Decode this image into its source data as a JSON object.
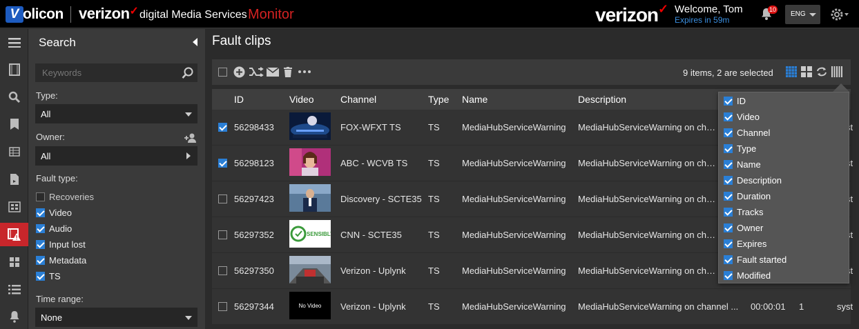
{
  "header": {
    "logo_volicon_v": "V",
    "logo_volicon_rest": "olicon",
    "brand_verizon": "verizon",
    "brand_check": "✓",
    "brand_dms": "digital Media Services",
    "brand_monitor": "Monitor",
    "brand_verizon_right": "verizon",
    "welcome": "Welcome, Tom",
    "expires": "Expires in 59m",
    "notifications_count": "10",
    "language": "ENG"
  },
  "rail": {
    "icons": [
      "menu-icon",
      "film-icon",
      "search-icon",
      "bookmark-icon",
      "table-icon",
      "document-icon",
      "grid-box-icon",
      "fault-clips-icon",
      "dashboard-icon",
      "list-icon",
      "bell-icon"
    ],
    "active": "fault-clips-icon"
  },
  "search": {
    "title": "Search",
    "keywords_placeholder": "Keywords",
    "type_label": "Type:",
    "type_value": "All",
    "owner_label": "Owner:",
    "owner_value": "All",
    "fault_type_label": "Fault type:",
    "fault_types": [
      {
        "label": "Recoveries",
        "checked": false
      },
      {
        "label": "Video",
        "checked": true
      },
      {
        "label": "Audio",
        "checked": true
      },
      {
        "label": "Input lost",
        "checked": true
      },
      {
        "label": "Metadata",
        "checked": true
      },
      {
        "label": "TS",
        "checked": true
      }
    ],
    "time_range_label": "Time range:",
    "time_range_value": "None"
  },
  "main": {
    "title": "Fault clips",
    "status": "9 items, 2 are selected",
    "columns": [
      "ID",
      "Video",
      "Channel",
      "Type",
      "Name",
      "Description"
    ],
    "rows": [
      {
        "checked": true,
        "id": "56298433",
        "channel": "FOX-WFXT TS",
        "type": "TS",
        "name": "MediaHubServiceWarning",
        "description": "MediaHubServiceWarning on channel",
        "duration": "",
        "tracks": "",
        "owner": "syst",
        "thumb": "fox"
      },
      {
        "checked": true,
        "id": "56298123",
        "channel": "ABC - WCVB TS",
        "type": "TS",
        "name": "MediaHubServiceWarning",
        "description": "MediaHubServiceWarning on channel",
        "duration": "",
        "tracks": "",
        "owner": "syst",
        "thumb": "abc"
      },
      {
        "checked": false,
        "id": "56297423",
        "channel": "Discovery - SCTE35",
        "type": "TS",
        "name": "MediaHubServiceWarning",
        "description": "MediaHubServiceWarning on channel",
        "duration": "",
        "tracks": "",
        "owner": "syst",
        "thumb": "discovery"
      },
      {
        "checked": false,
        "id": "56297352",
        "channel": "CNN - SCTE35",
        "type": "TS",
        "name": "MediaHubServiceWarning",
        "description": "MediaHubServiceWarning on channel",
        "duration": "",
        "tracks": "",
        "owner": "syst",
        "thumb": "cnn"
      },
      {
        "checked": false,
        "id": "56297350",
        "channel": "Verizon - Uplynk",
        "type": "TS",
        "name": "MediaHubServiceWarning",
        "description": "MediaHubServiceWarning on channel",
        "duration": "",
        "tracks": "",
        "owner": "syst",
        "thumb": "verizon"
      },
      {
        "checked": false,
        "id": "56297344",
        "channel": "Verizon - Uplynk",
        "type": "TS",
        "name": "MediaHubServiceWarning",
        "description": "MediaHubServiceWarning on channel ...",
        "duration": "00:00:01",
        "tracks": "1",
        "owner": "syst",
        "thumb": "novideo"
      }
    ],
    "thumb_text_sensibly": "SENSIBLY",
    "thumb_text_novideo": "No Video"
  },
  "column_chooser": {
    "items": [
      {
        "label": "ID",
        "checked": true
      },
      {
        "label": "Video",
        "checked": true
      },
      {
        "label": "Channel",
        "checked": true
      },
      {
        "label": "Type",
        "checked": true
      },
      {
        "label": "Name",
        "checked": true
      },
      {
        "label": "Description",
        "checked": true
      },
      {
        "label": "Duration",
        "checked": true
      },
      {
        "label": "Tracks",
        "checked": true
      },
      {
        "label": "Owner",
        "checked": true
      },
      {
        "label": "Expires",
        "checked": true
      },
      {
        "label": "Fault started",
        "checked": true
      },
      {
        "label": "Modified",
        "checked": true
      }
    ]
  },
  "colors": {
    "accent": "#2a7fd6",
    "brand_red": "#d42222",
    "active_rail": "#c8262b",
    "expires_blue": "#3b8fe0"
  }
}
